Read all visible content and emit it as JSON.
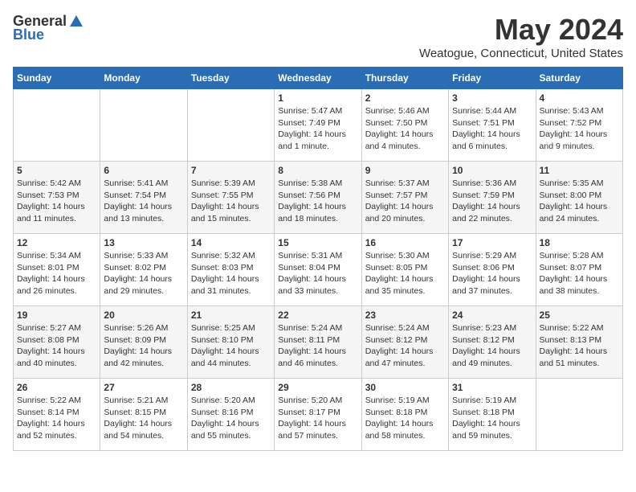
{
  "logo": {
    "general": "General",
    "blue": "Blue"
  },
  "title": "May 2024",
  "subtitle": "Weatogue, Connecticut, United States",
  "days": [
    "Sunday",
    "Monday",
    "Tuesday",
    "Wednesday",
    "Thursday",
    "Friday",
    "Saturday"
  ],
  "weeks": [
    [
      {
        "day": "",
        "content": ""
      },
      {
        "day": "",
        "content": ""
      },
      {
        "day": "",
        "content": ""
      },
      {
        "day": "1",
        "content": "Sunrise: 5:47 AM\nSunset: 7:49 PM\nDaylight: 14 hours\nand 1 minute."
      },
      {
        "day": "2",
        "content": "Sunrise: 5:46 AM\nSunset: 7:50 PM\nDaylight: 14 hours\nand 4 minutes."
      },
      {
        "day": "3",
        "content": "Sunrise: 5:44 AM\nSunset: 7:51 PM\nDaylight: 14 hours\nand 6 minutes."
      },
      {
        "day": "4",
        "content": "Sunrise: 5:43 AM\nSunset: 7:52 PM\nDaylight: 14 hours\nand 9 minutes."
      }
    ],
    [
      {
        "day": "5",
        "content": "Sunrise: 5:42 AM\nSunset: 7:53 PM\nDaylight: 14 hours\nand 11 minutes."
      },
      {
        "day": "6",
        "content": "Sunrise: 5:41 AM\nSunset: 7:54 PM\nDaylight: 14 hours\nand 13 minutes."
      },
      {
        "day": "7",
        "content": "Sunrise: 5:39 AM\nSunset: 7:55 PM\nDaylight: 14 hours\nand 15 minutes."
      },
      {
        "day": "8",
        "content": "Sunrise: 5:38 AM\nSunset: 7:56 PM\nDaylight: 14 hours\nand 18 minutes."
      },
      {
        "day": "9",
        "content": "Sunrise: 5:37 AM\nSunset: 7:57 PM\nDaylight: 14 hours\nand 20 minutes."
      },
      {
        "day": "10",
        "content": "Sunrise: 5:36 AM\nSunset: 7:59 PM\nDaylight: 14 hours\nand 22 minutes."
      },
      {
        "day": "11",
        "content": "Sunrise: 5:35 AM\nSunset: 8:00 PM\nDaylight: 14 hours\nand 24 minutes."
      }
    ],
    [
      {
        "day": "12",
        "content": "Sunrise: 5:34 AM\nSunset: 8:01 PM\nDaylight: 14 hours\nand 26 minutes."
      },
      {
        "day": "13",
        "content": "Sunrise: 5:33 AM\nSunset: 8:02 PM\nDaylight: 14 hours\nand 29 minutes."
      },
      {
        "day": "14",
        "content": "Sunrise: 5:32 AM\nSunset: 8:03 PM\nDaylight: 14 hours\nand 31 minutes."
      },
      {
        "day": "15",
        "content": "Sunrise: 5:31 AM\nSunset: 8:04 PM\nDaylight: 14 hours\nand 33 minutes."
      },
      {
        "day": "16",
        "content": "Sunrise: 5:30 AM\nSunset: 8:05 PM\nDaylight: 14 hours\nand 35 minutes."
      },
      {
        "day": "17",
        "content": "Sunrise: 5:29 AM\nSunset: 8:06 PM\nDaylight: 14 hours\nand 37 minutes."
      },
      {
        "day": "18",
        "content": "Sunrise: 5:28 AM\nSunset: 8:07 PM\nDaylight: 14 hours\nand 38 minutes."
      }
    ],
    [
      {
        "day": "19",
        "content": "Sunrise: 5:27 AM\nSunset: 8:08 PM\nDaylight: 14 hours\nand 40 minutes."
      },
      {
        "day": "20",
        "content": "Sunrise: 5:26 AM\nSunset: 8:09 PM\nDaylight: 14 hours\nand 42 minutes."
      },
      {
        "day": "21",
        "content": "Sunrise: 5:25 AM\nSunset: 8:10 PM\nDaylight: 14 hours\nand 44 minutes."
      },
      {
        "day": "22",
        "content": "Sunrise: 5:24 AM\nSunset: 8:11 PM\nDaylight: 14 hours\nand 46 minutes."
      },
      {
        "day": "23",
        "content": "Sunrise: 5:24 AM\nSunset: 8:12 PM\nDaylight: 14 hours\nand 47 minutes."
      },
      {
        "day": "24",
        "content": "Sunrise: 5:23 AM\nSunset: 8:12 PM\nDaylight: 14 hours\nand 49 minutes."
      },
      {
        "day": "25",
        "content": "Sunrise: 5:22 AM\nSunset: 8:13 PM\nDaylight: 14 hours\nand 51 minutes."
      }
    ],
    [
      {
        "day": "26",
        "content": "Sunrise: 5:22 AM\nSunset: 8:14 PM\nDaylight: 14 hours\nand 52 minutes."
      },
      {
        "day": "27",
        "content": "Sunrise: 5:21 AM\nSunset: 8:15 PM\nDaylight: 14 hours\nand 54 minutes."
      },
      {
        "day": "28",
        "content": "Sunrise: 5:20 AM\nSunset: 8:16 PM\nDaylight: 14 hours\nand 55 minutes."
      },
      {
        "day": "29",
        "content": "Sunrise: 5:20 AM\nSunset: 8:17 PM\nDaylight: 14 hours\nand 57 minutes."
      },
      {
        "day": "30",
        "content": "Sunrise: 5:19 AM\nSunset: 8:18 PM\nDaylight: 14 hours\nand 58 minutes."
      },
      {
        "day": "31",
        "content": "Sunrise: 5:19 AM\nSunset: 8:18 PM\nDaylight: 14 hours\nand 59 minutes."
      },
      {
        "day": "",
        "content": ""
      }
    ]
  ]
}
